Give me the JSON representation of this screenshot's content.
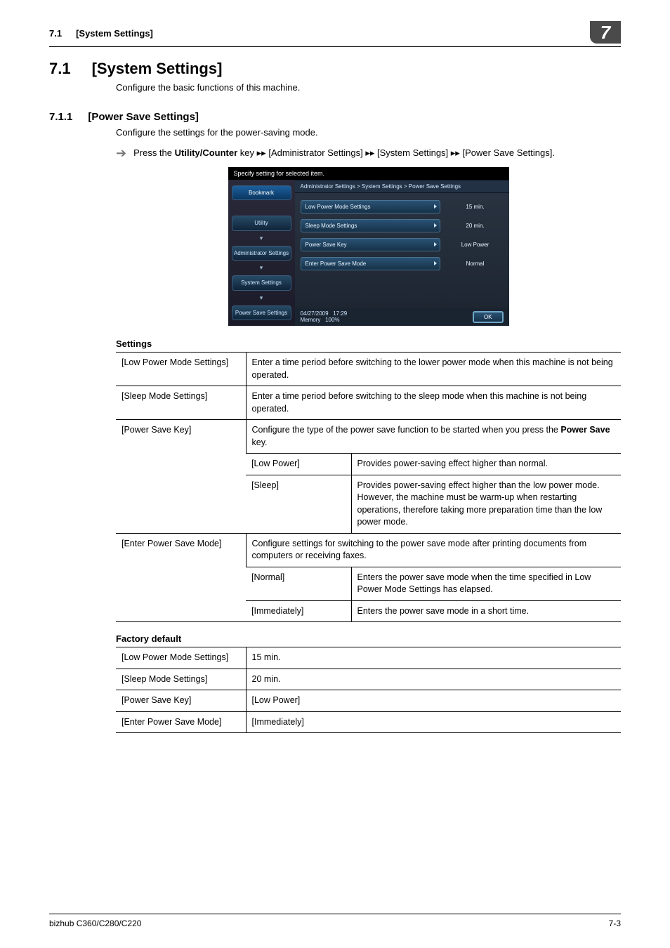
{
  "running_head": {
    "num": "7.1",
    "title": "[System Settings]"
  },
  "chapter_badge": "7",
  "h1": {
    "num": "7.1",
    "title": "[System Settings]"
  },
  "intro1": "Configure the basic functions of this machine.",
  "h2": {
    "num": "7.1.1",
    "title": "[Power Save Settings]"
  },
  "intro2": "Configure the settings for the power-saving mode.",
  "step": {
    "pre": "Press the ",
    "key": "Utility/Counter",
    "post1": " key ",
    "sep": "▸▸",
    "seg1": " [Administrator Settings] ",
    "seg2": " [System Settings] ",
    "seg3": " [Power Save Settings]."
  },
  "panel": {
    "instruction": "Specify setting for selected item.",
    "crumb": "Administrator Settings > System Settings > Power Save Settings",
    "left": {
      "bookmark": "Bookmark",
      "utility": "Utility",
      "admin": "Administrator Settings",
      "system": "System Settings",
      "power": "Power Save Settings"
    },
    "rows": [
      {
        "label": "Low Power Mode Settings",
        "value": "15 min."
      },
      {
        "label": "Sleep Mode Settings",
        "value": "20 min."
      },
      {
        "label": "Power Save Key",
        "value": "Low Power"
      },
      {
        "label": "Enter Power Save Mode",
        "value": "Normal"
      }
    ],
    "footer": {
      "date": "04/27/2009",
      "time": "17:29",
      "mem_label": "Memory",
      "mem_val": "100%",
      "ok": "OK"
    }
  },
  "settings_title": "Settings",
  "settings": {
    "r1": {
      "a": "[Low Power Mode Settings]",
      "b": "Enter a time period before switching to the lower power mode when this machine is not being operated."
    },
    "r2": {
      "a": "[Sleep Mode Settings]",
      "b": "Enter a time period before switching to the sleep mode when this machine is not being operated."
    },
    "r3": {
      "a": "[Power Save Key]",
      "lead_pre": "Configure the type of the power save function to be started when you press the ",
      "lead_bold": "Power Save",
      "lead_post": " key.",
      "sub1": {
        "a": "[Low Power]",
        "b": "Provides power-saving effect higher than normal."
      },
      "sub2": {
        "a": "[Sleep]",
        "b": "Provides power-saving effect higher than the low power mode. However, the machine must be warm-up when restarting operations, therefore taking more preparation time than the low power mode."
      }
    },
    "r4": {
      "a": "[Enter Power Save Mode]",
      "lead": "Configure settings for switching to the power save mode after printing documents from computers or receiving faxes.",
      "sub1": {
        "a": "[Normal]",
        "b": "Enters the power save mode when the time specified in Low Power Mode Settings has elapsed."
      },
      "sub2": {
        "a": "[Immediately]",
        "b": "Enters the power save mode in a short time."
      }
    }
  },
  "defaults_title": "Factory default",
  "defaults": [
    {
      "a": "[Low Power Mode Settings]",
      "b": "15 min."
    },
    {
      "a": "[Sleep Mode Settings]",
      "b": "20 min."
    },
    {
      "a": "[Power Save Key]",
      "b": "[Low Power]"
    },
    {
      "a": "[Enter Power Save Mode]",
      "b": "[Immediately]"
    }
  ],
  "footer": {
    "left": "bizhub C360/C280/C220",
    "right": "7-3"
  }
}
